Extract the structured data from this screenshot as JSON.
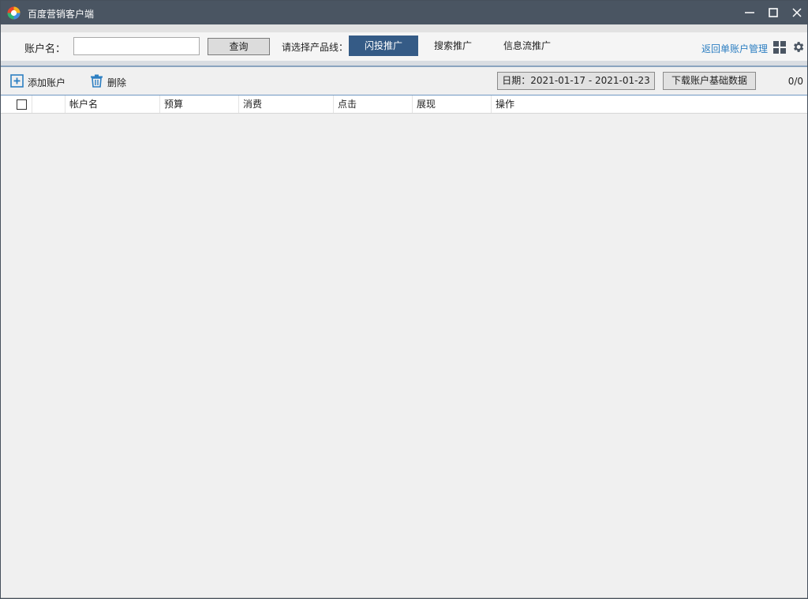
{
  "window": {
    "title": "百度营销客户端",
    "accent_color": "#4a5562"
  },
  "search": {
    "account_label": "账户名：",
    "account_value": "",
    "query_button": "查询",
    "product_line_label": "请选择产品线："
  },
  "product_tabs": [
    {
      "label": "闪投推广",
      "active": true
    },
    {
      "label": "搜索推广",
      "active": false
    },
    {
      "label": "信息流推广",
      "active": false
    }
  ],
  "header_right": {
    "back_link": "返回单账户管理",
    "grid_icon": "grid-icon",
    "settings_icon": "gear-icon"
  },
  "toolbar": {
    "add_account": "添加账户",
    "delete": "删除",
    "date_range": "日期：2021-01-17 - 2021-01-23",
    "download_button": "下载账户基础数据",
    "count": "0/0"
  },
  "table": {
    "columns": [
      "帐户名",
      "预算",
      "消费",
      "点击",
      "展现",
      "操作"
    ],
    "rows": []
  },
  "colors": {
    "active_tab": "#355b86",
    "link": "#2d7fc2",
    "titlebar": "#4a5562"
  }
}
